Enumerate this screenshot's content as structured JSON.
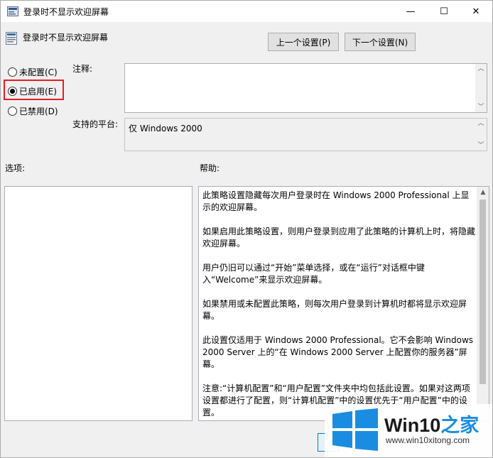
{
  "window": {
    "title": "登录时不显示欢迎屏幕",
    "minimize_glyph": "—",
    "maximize_glyph": "☐",
    "close_glyph": "✕"
  },
  "header": {
    "title": "登录时不显示欢迎屏幕"
  },
  "nav": {
    "prev_label": "上一个设置(P)",
    "next_label": "下一个设置(N)"
  },
  "radios": [
    {
      "label": "未配置(C)",
      "checked": false
    },
    {
      "label": "已启用(E)",
      "checked": true
    },
    {
      "label": "已禁用(D)",
      "checked": false
    }
  ],
  "labels": {
    "comment": "注释:",
    "platform": "支持的平台:",
    "options": "选项:",
    "help": "帮助:"
  },
  "comment_value": "",
  "platform_value": "仅 Windows 2000",
  "help_paragraphs": [
    "此策略设置隐藏每次用户登录时在 Windows 2000 Professional 上显示的欢迎屏幕。",
    "如果启用此策略设置，则用户登录到应用了此策略的计算机上时，将隐藏欢迎屏幕。",
    "用户仍旧可以通过“开始”菜单选择，或在“运行”对话框中键入“Welcome”来显示欢迎屏幕。",
    "如果禁用或未配置此策略，则每次用户登录到计算机时都将显示欢迎屏幕。",
    "此设置仅适用于 Windows 2000 Professional。它不会影响 Windows 2000 Server 上的“在 Windows 2000 Server 上配置你的服务器”屏幕。",
    "注意:“计算机配置”和“用户配置”文件夹中均包括此设置。如果对这两项设置都进行了配置，则“计算机配置”中的设置优先于“用户配置”中的设置。"
  ],
  "watermark": {
    "brand_main": "Win10",
    "brand_accent": "之家",
    "url": "www.win10xitong.com"
  },
  "colors": {
    "highlight": "#e81c24",
    "accent_blue": "#1a8de1"
  }
}
